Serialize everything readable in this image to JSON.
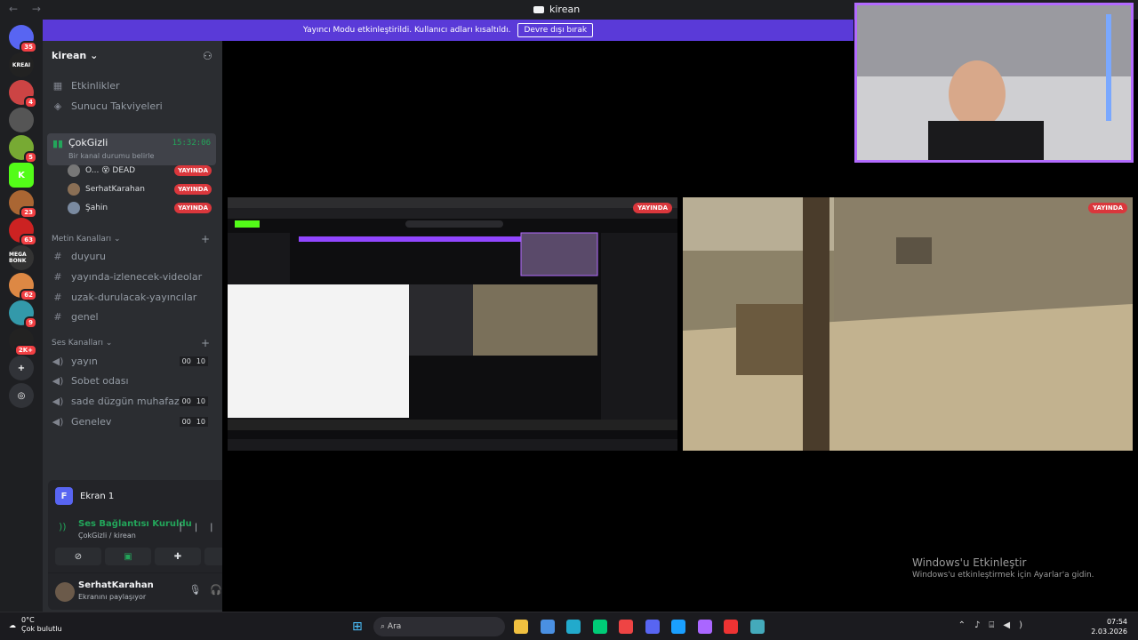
{
  "window": {
    "title": "kirean",
    "nav": "← →"
  },
  "banner": {
    "text": "Yayıncı Modu etkinleştirildi. Kullanıcı adları kısaltıldı.",
    "button": "Devre dışı bırak"
  },
  "servers": [
    {
      "label": "",
      "badge": "35",
      "color": "#5865f2"
    },
    {
      "label": "KREAI",
      "badge": "",
      "color": "#222"
    },
    {
      "label": "",
      "badge": "4",
      "color": "#c44"
    },
    {
      "label": "",
      "badge": "",
      "color": "#555"
    },
    {
      "label": "",
      "badge": "5",
      "color": "#7a3"
    },
    {
      "label": "K",
      "badge": "",
      "color": "#53fc18"
    },
    {
      "label": "",
      "badge": "23",
      "color": "#a63"
    },
    {
      "label": "",
      "badge": "63",
      "color": "#c22"
    },
    {
      "label": "MEGA BONK",
      "badge": "",
      "color": "#333"
    },
    {
      "label": "",
      "badge": "62",
      "color": "#d84"
    },
    {
      "label": "",
      "badge": "9",
      "color": "#39a"
    },
    {
      "label": "",
      "badge": "2K+",
      "color": "#222"
    },
    {
      "label": "+",
      "badge": "",
      "color": "#313338"
    },
    {
      "label": "◎",
      "badge": "",
      "color": "#313338"
    }
  ],
  "sidebar": {
    "server_name": "kirean",
    "top_items": [
      {
        "icon": "calendar-icon",
        "label": "Etkinlikler"
      },
      {
        "icon": "boost-icon",
        "label": "Sunucu Takviyeleri"
      }
    ],
    "active_voice": {
      "name": "ÇokGizli",
      "time": "15:32:06",
      "status": "Bir kanal durumu belirle"
    },
    "voice_users": [
      {
        "name": "O... 😵 DEAD",
        "live": "YAYINDA"
      },
      {
        "name": "SerhatKarahan",
        "live": "YAYINDA"
      },
      {
        "name": "Şahin",
        "live": "YAYINDA"
      }
    ],
    "text_category": "Metin Kanalları",
    "text_channels": [
      "duyuru",
      "yayında-izlenecek-videolar",
      "uzak-durulacak-yayıncılar",
      "genel"
    ],
    "voice_category": "Ses Kanalları",
    "voice_channels": [
      {
        "name": "yayın",
        "a": "00",
        "b": "10"
      },
      {
        "name": "Sobet odası",
        "a": "",
        "b": ""
      },
      {
        "name": "sade düzgün muhafaza...",
        "a": "00",
        "b": "10"
      },
      {
        "name": "Genelev",
        "a": "00",
        "b": "10"
      }
    ]
  },
  "panel": {
    "screen_initial": "F",
    "screen_label": "Ekran 1",
    "connection": "Ses Bağlantısı Kuruldu",
    "connection_sub": "ÇokGizli / kirean",
    "user_name": "SerhatKarahan",
    "user_status": "Ekranını paylaşıyor"
  },
  "streams": {
    "tag": "YAYINDA"
  },
  "watermark": {
    "title": "Windows'u Etkinleştir",
    "sub": "Windows'u etkinleştirmek için Ayarlar'a gidin."
  },
  "taskbar": {
    "temp": "0°C",
    "weather": "Çok bulutlu",
    "search": "Ara",
    "time": "07:54",
    "date": "2.03.2026",
    "apps": [
      "#f0c040",
      "#4a90e2",
      "#2ac",
      "#0c7",
      "#e44",
      "#5865f2",
      "#1a9fff",
      "#a6f",
      "#e33",
      "#4ab"
    ]
  }
}
